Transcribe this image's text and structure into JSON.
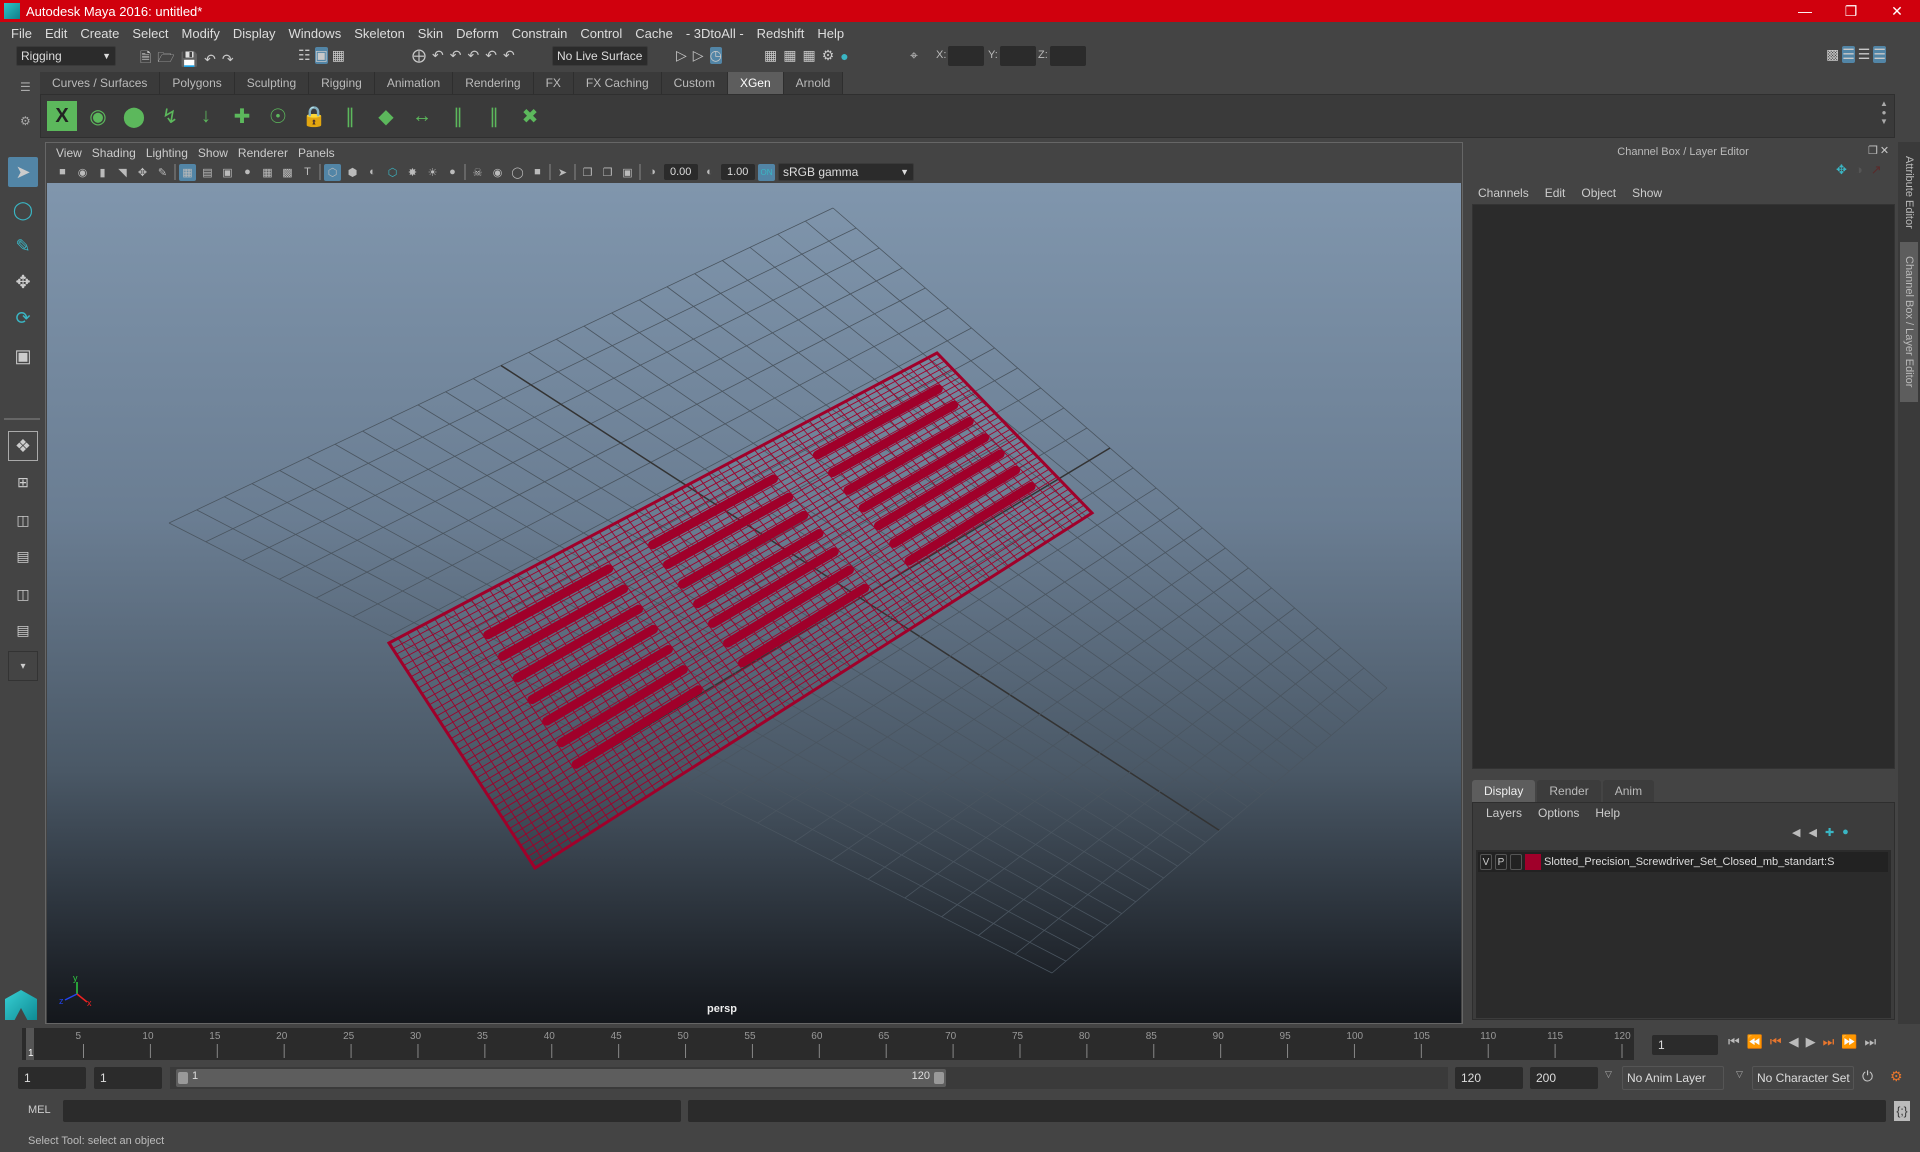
{
  "window": {
    "title": "Autodesk Maya 2016: untitled*",
    "controls": [
      "minimize-icon",
      "restore-icon",
      "close-icon"
    ]
  },
  "menubar": [
    "File",
    "Edit",
    "Create",
    "Select",
    "Modify",
    "Display",
    "Windows",
    "Skeleton",
    "Skin",
    "Deform",
    "Constrain",
    "Control",
    "Cache",
    "- 3DtoAll -",
    "Redshift",
    "Help"
  ],
  "statusline": {
    "menuset": "Rigging",
    "live_surface": "No Live Surface",
    "x_label": "X:",
    "y_label": "Y:",
    "z_label": "Z:",
    "x_value": "",
    "y_value": "",
    "z_value": ""
  },
  "shelf": {
    "tabs": [
      "Curves / Surfaces",
      "Polygons",
      "Sculpting",
      "Rigging",
      "Animation",
      "Rendering",
      "FX",
      "FX Caching",
      "Custom",
      "XGen",
      "Arnold"
    ],
    "active_tab": "XGen",
    "icons": [
      "xgen-window-icon",
      "xgen-preview-icon",
      "xgen-clear-preview-icon",
      "add-guides-icon",
      "move-guide-icon",
      "add-guide-icon",
      "sculpt-guide-icon",
      "lock-guide-icon",
      "rebuild-guides-icon",
      "xgen-patch-icon",
      "flip-guides-icon",
      "select-guides-icon",
      "normalize-guides-icon",
      "delete-guides-icon"
    ]
  },
  "toolbox": [
    "select-tool-icon",
    "lasso-tool-icon",
    "paint-select-icon",
    "move-tool-icon",
    "rotate-tool-icon",
    "scale-tool-icon",
    "single-perspective-layout-icon",
    "four-view-layout-icon",
    "persp-outliner-layout-icon",
    "persp-graph-layout-icon",
    "persp-hypershade-layout-icon",
    "persp-outliner-graph-layout-icon",
    "more-layouts-icon"
  ],
  "viewport": {
    "menus": [
      "View",
      "Shading",
      "Lighting",
      "Show",
      "Renderer",
      "Panels"
    ],
    "exposure": "0.00",
    "gamma": "1.00",
    "color_space": "sRGB gamma",
    "camera_label": "persp",
    "axis": {
      "x": "x",
      "y": "y",
      "z": "z"
    },
    "wire_color": "#a0002a"
  },
  "channel_box": {
    "title": "Channel Box / Layer Editor",
    "menus": [
      "Channels",
      "Edit",
      "Object",
      "Show"
    ]
  },
  "layer_editor": {
    "tabs": [
      "Display",
      "Render",
      "Anim"
    ],
    "active_tab": "Display",
    "menus": [
      "Layers",
      "Options",
      "Help"
    ],
    "layers": [
      {
        "visible": "V",
        "playback": "P",
        "color": "#a0002a",
        "name": "Slotted_Precision_Screwdriver_Set_Closed_mb_standart:S"
      }
    ]
  },
  "side_tabs": [
    "Attribute Editor",
    "Channel Box / Layer Editor"
  ],
  "timeline": {
    "ticks": [
      5,
      10,
      15,
      20,
      25,
      30,
      35,
      40,
      45,
      50,
      55,
      60,
      65,
      70,
      75,
      80,
      85,
      90,
      95,
      100,
      105,
      110,
      115,
      120
    ],
    "current_frame": "1",
    "current_frame_field": "1"
  },
  "range": {
    "start_time": "1",
    "playback_start": "1",
    "slider_start": "1",
    "slider_end": "120",
    "playback_end": "120",
    "end_time": "200",
    "anim_layer": "No Anim Layer",
    "character_set": "No Character Set"
  },
  "command": {
    "language": "MEL",
    "input": "",
    "output": ""
  },
  "help_line": "Select Tool: select an object"
}
